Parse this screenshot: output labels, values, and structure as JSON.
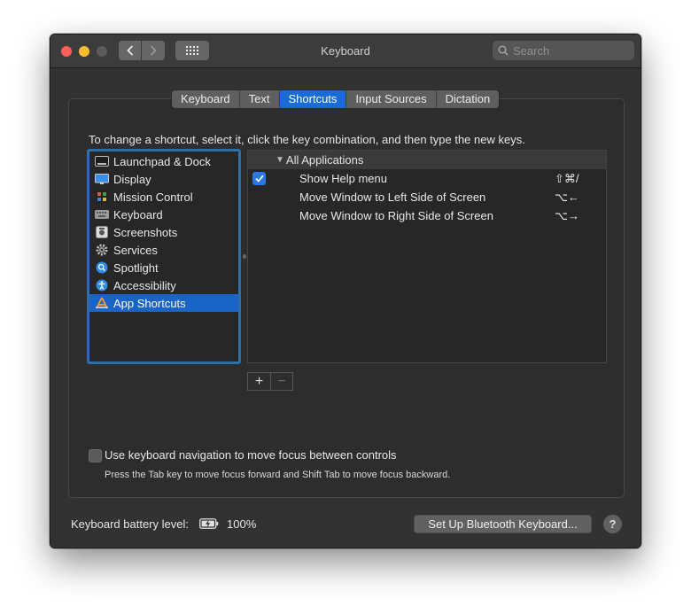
{
  "window": {
    "title": "Keyboard",
    "search_placeholder": "Search"
  },
  "tabs": [
    {
      "label": "Keyboard",
      "active": false
    },
    {
      "label": "Text",
      "active": false
    },
    {
      "label": "Shortcuts",
      "active": true
    },
    {
      "label": "Input Sources",
      "active": false
    },
    {
      "label": "Dictation",
      "active": false
    }
  ],
  "instruction": "To change a shortcut, select it, click the key combination, and then type the new keys.",
  "categories": [
    {
      "label": "Launchpad & Dock",
      "icon": "launchpad-icon",
      "selected": false
    },
    {
      "label": "Display",
      "icon": "display-icon",
      "selected": false
    },
    {
      "label": "Mission Control",
      "icon": "mission-control-icon",
      "selected": false
    },
    {
      "label": "Keyboard",
      "icon": "keyboard-icon",
      "selected": false
    },
    {
      "label": "Screenshots",
      "icon": "screenshot-icon",
      "selected": false
    },
    {
      "label": "Services",
      "icon": "gear-icon",
      "selected": false
    },
    {
      "label": "Spotlight",
      "icon": "spotlight-icon",
      "selected": false
    },
    {
      "label": "Accessibility",
      "icon": "accessibility-icon",
      "selected": false
    },
    {
      "label": "App Shortcuts",
      "icon": "app-store-icon",
      "selected": true
    }
  ],
  "shortcuts": {
    "group_label": "All Applications",
    "items": [
      {
        "name": "Show Help menu",
        "keys": "⇧⌘/",
        "checked": true,
        "has_checkbox": true
      },
      {
        "name": "Move Window to Left Side of Screen",
        "keys": "⌥←",
        "checked": false,
        "has_checkbox": false
      },
      {
        "name": "Move Window to Right Side of Screen",
        "keys": "⌥→",
        "checked": false,
        "has_checkbox": false
      }
    ]
  },
  "controls": {
    "add_label": "+",
    "remove_label": "−"
  },
  "keyboard_navigation": {
    "label": "Use keyboard navigation to move focus between controls",
    "hint": "Press the Tab key to move focus forward and Shift Tab to move focus backward.",
    "checked": false
  },
  "battery": {
    "label": "Keyboard battery level:",
    "value": "100%"
  },
  "bluetooth_button_label": "Set Up Bluetooth Keyboard...",
  "help_label": "?",
  "colors": {
    "accent": "#1a6bd6",
    "window_bg": "#323232",
    "close": "#ff5f57",
    "minimize": "#febc2e"
  }
}
